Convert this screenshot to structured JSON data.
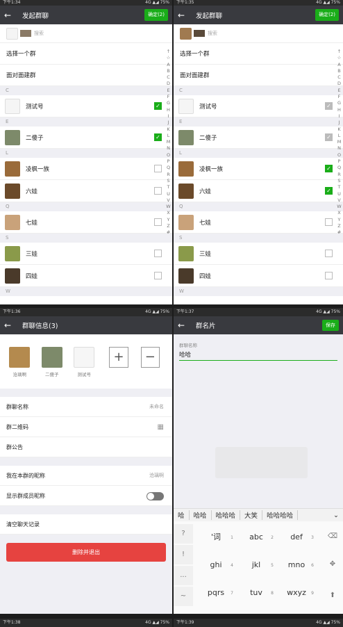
{
  "panel_a": {
    "status": {
      "left": "下午1:34",
      "right": "4G ▲◢ 75%"
    },
    "title": "发起群聊",
    "ok_label": "确定(2)",
    "search_placeholder": "搜索",
    "rows": [
      "选择一个群",
      "面对面建群"
    ],
    "sections": [
      {
        "letter": "C",
        "contacts": [
          {
            "name": "测试号",
            "state": "on"
          }
        ]
      },
      {
        "letter": "E",
        "contacts": [
          {
            "name": "二傻子",
            "state": "on"
          }
        ]
      },
      {
        "letter": "L",
        "contacts": [
          {
            "name": "凌枫一族",
            "state": "off"
          },
          {
            "name": "六娃",
            "state": "off"
          }
        ]
      },
      {
        "letter": "Q",
        "contacts": [
          {
            "name": "七娃",
            "state": "off"
          }
        ]
      },
      {
        "letter": "S",
        "contacts": [
          {
            "name": "三娃",
            "state": "off"
          },
          {
            "name": "四娃",
            "state": "off"
          }
        ]
      },
      {
        "letter": "W",
        "contacts": []
      }
    ]
  },
  "panel_b": {
    "status": {
      "left": "下午1:35",
      "right": "4G ▲◢ 75%"
    },
    "title": "发起群聊",
    "ok_label": "确定(2)",
    "search_placeholder": "搜索",
    "rows": [
      "选择一个群",
      "面对面建群"
    ],
    "sections": [
      {
        "letter": "C",
        "contacts": [
          {
            "name": "测试号",
            "state": "dis"
          }
        ]
      },
      {
        "letter": "E",
        "contacts": [
          {
            "name": "二傻子",
            "state": "dis"
          }
        ]
      },
      {
        "letter": "L",
        "contacts": [
          {
            "name": "凌枫一族",
            "state": "on"
          },
          {
            "name": "六娃",
            "state": "on"
          }
        ]
      },
      {
        "letter": "Q",
        "contacts": [
          {
            "name": "七娃",
            "state": "off"
          }
        ]
      },
      {
        "letter": "S",
        "contacts": [
          {
            "name": "三娃",
            "state": "off"
          },
          {
            "name": "四娃",
            "state": "off"
          }
        ]
      },
      {
        "letter": "W",
        "contacts": []
      }
    ]
  },
  "index_letters": [
    "↑",
    "☆",
    "A",
    "B",
    "C",
    "D",
    "E",
    "F",
    "G",
    "H",
    "I",
    "J",
    "K",
    "L",
    "M",
    "N",
    "O",
    "P",
    "Q",
    "R",
    "S",
    "T",
    "U",
    "V",
    "W",
    "X",
    "Y",
    "Z",
    "#"
  ],
  "panel_c": {
    "status": {
      "left": "下午1:36",
      "right": "4G ▲◢ 75%"
    },
    "title": "群聊信息(3)",
    "members": [
      "沧璃啊",
      "二傻子",
      "测试号"
    ],
    "add_label": "+",
    "remove_label": "−",
    "group_name_label": "群聊名称",
    "group_name_value": "未命名",
    "qr_label": "群二维码",
    "notice_label": "群公告",
    "nickname_label": "我在本群的昵称",
    "nickname_value": "沧璃啊",
    "show_nick_label": "显示群成员昵称",
    "clear_label": "清空聊天记录",
    "delete_label": "删除并退出"
  },
  "panel_d": {
    "status": {
      "left": "下午1:37",
      "right": "4G ▲◢ 75%"
    },
    "title": "群名片",
    "save_label": "保存",
    "field_label": "群聊名称",
    "field_value": "哈哈",
    "suggestions": [
      "哈",
      "哈哈",
      "哈哈哈",
      "大笑",
      "哈哈哈哈",
      "⌄"
    ],
    "keys": [
      {
        "label": "'词",
        "num": "1"
      },
      {
        "label": "abc",
        "num": "2"
      },
      {
        "label": "def",
        "num": "3"
      },
      {
        "label": "ghi",
        "num": "4"
      },
      {
        "label": "jkl",
        "num": "5"
      },
      {
        "label": "mno",
        "num": "6"
      },
      {
        "label": "pqrs",
        "num": "7"
      },
      {
        "label": "tuv",
        "num": "8"
      },
      {
        "label": "wxyz",
        "num": "9"
      }
    ],
    "side_keys": [
      "?",
      "!",
      "...",
      "~"
    ]
  },
  "bottom_status": {
    "left1": "下午1:38",
    "right1": "4G ▲◢ 75%",
    "left2": "下午1:39",
    "right2": "4G ▲◢ 75%"
  },
  "colors": {
    "header": "#393a3f",
    "green": "#1aad19",
    "red": "#e64340",
    "section": "#efeff4"
  }
}
